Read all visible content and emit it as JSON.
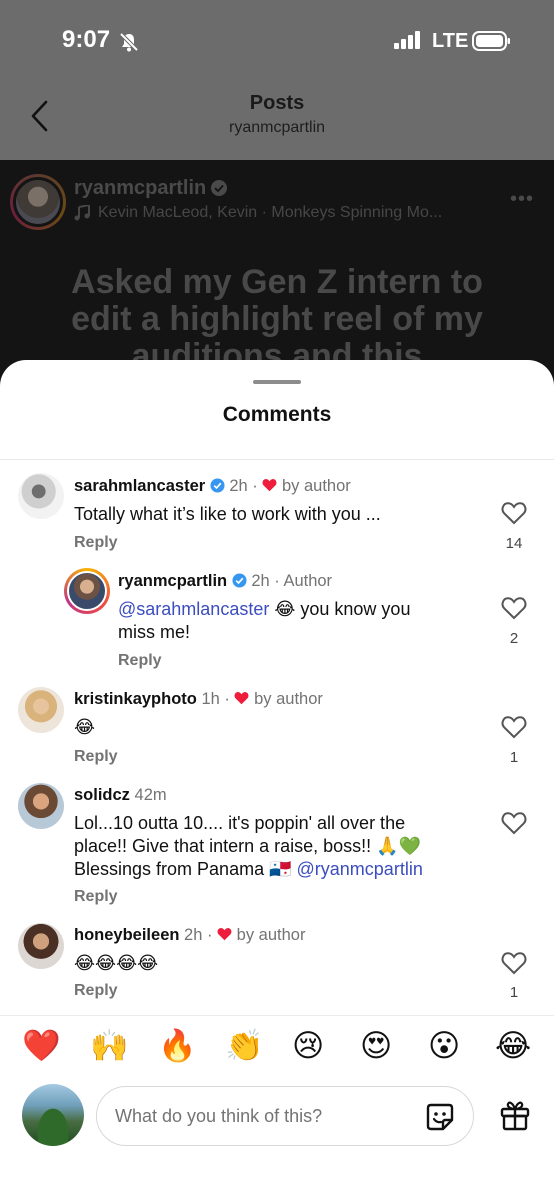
{
  "status_bar": {
    "time": "9:07",
    "network": "LTE"
  },
  "header": {
    "title": "Posts",
    "subtitle": "ryanmcpartlin"
  },
  "post": {
    "username": "ryanmcpartlin",
    "music": "Kevin MacLeod, Kevin · Monkeys Spinning Mo...",
    "caption": "Asked my Gen Z intern to edit a highlight reel of my auditions and this"
  },
  "sheet": {
    "title": "Comments"
  },
  "comments": [
    {
      "username": "sarahmlancaster",
      "verified": true,
      "time": "2h",
      "meta": "by author",
      "text": "Totally what it’s like to work with you ...",
      "reply": "Reply",
      "likes": "14"
    },
    {
      "username": "ryanmcpartlin",
      "verified": true,
      "time": "2h",
      "meta": "Author",
      "mention": "@sarahmlancaster",
      "text_after": "😂 you know you",
      "text_line2": "miss me!",
      "reply": "Reply",
      "likes": "2"
    },
    {
      "username": "kristinkayphoto",
      "time": "1h",
      "meta": "by author",
      "text": "😂",
      "reply": "Reply",
      "likes": "1"
    },
    {
      "username": "solidcz",
      "time": "42m",
      "text_line1": "Lol...10 outta 10.... it's poppin'  all over the",
      "text_line2": "place!! Give that intern a raise, boss!! 🙏💚",
      "text_line3": "Blessings from Panama 🇵🇦",
      "mention": "@ryanmcpartlin",
      "reply": "Reply"
    },
    {
      "username": "honeybeileen",
      "time": "2h",
      "meta": "by author",
      "text": "😂😂😂😂",
      "reply": "Reply",
      "likes": "1"
    }
  ],
  "reactions": [
    "❤️",
    "🙌",
    "🔥",
    "👏",
    "😢",
    "😍",
    "😮",
    "😂"
  ],
  "composer": {
    "placeholder": "What do you think of this?"
  },
  "icons": [
    "bell-slash-icon",
    "signal-icon",
    "battery-icon",
    "back-chevron-icon",
    "verified-icon",
    "music-note-icon",
    "more-icon",
    "heart-icon",
    "sticker-icon",
    "gift-icon"
  ],
  "colors": {
    "verified": "#3797f0",
    "like_red": "#ee1d3b",
    "mention": "#3b4dbf"
  }
}
